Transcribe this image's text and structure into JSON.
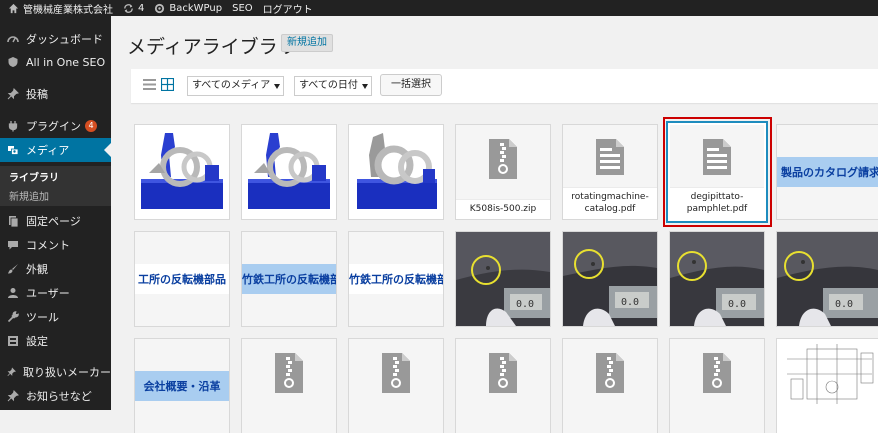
{
  "adminbar": {
    "site_name": "管機械産業株式会社",
    "updates_count": "4",
    "backwpup": "BackWPup",
    "seo": "SEO",
    "logout": "ログアウト"
  },
  "sidebar": {
    "items": [
      {
        "label": "ダッシュボード",
        "icon": "dashboard-icon"
      },
      {
        "label": "All in One SEO",
        "icon": "shield-icon"
      },
      {
        "label": "投稿",
        "icon": "pin-icon"
      },
      {
        "label": "プラグイン",
        "icon": "plugin-icon",
        "badge": "4"
      },
      {
        "label": "メディア",
        "icon": "media-icon"
      },
      {
        "label": "固定ページ",
        "icon": "page-icon"
      },
      {
        "label": "コメント",
        "icon": "comment-icon"
      },
      {
        "label": "外観",
        "icon": "brush-icon"
      },
      {
        "label": "ユーザー",
        "icon": "user-icon"
      },
      {
        "label": "ツール",
        "icon": "wrench-icon"
      },
      {
        "label": "設定",
        "icon": "settings-icon"
      },
      {
        "label": "取り扱いメーカー",
        "icon": "pin-icon"
      },
      {
        "label": "お知らせなど",
        "icon": "pin-icon"
      }
    ],
    "submenu": [
      "ライブラリ",
      "新規追加"
    ]
  },
  "main": {
    "title": "メディアライブラリ",
    "add_new": "新規追加",
    "filter_type": "すべてのメディア",
    "filter_date": "すべての日付",
    "bulk_select": "一括選択"
  },
  "attachments": {
    "zip1": "K508is-500.zip",
    "pdf1": "rotatingmachine-\ncatalog.pdf",
    "pdf2": "degipittato-\npamphlet.pdf",
    "banner_catalog": "製品のカタログ請求はこ",
    "banner_1": "工所の反転機部品",
    "banner_2": "竹鉄工所の反転機部",
    "banner_3": "竹鉄工所の反転機部",
    "banner_company": "会社概要・沿革",
    "gauge": "0.0"
  },
  "colors": {
    "adminbar": "#222222",
    "sidebar": "#222222",
    "accent": "#0074a2",
    "badge": "#d54e21",
    "selection_frame": "#cc0000"
  }
}
